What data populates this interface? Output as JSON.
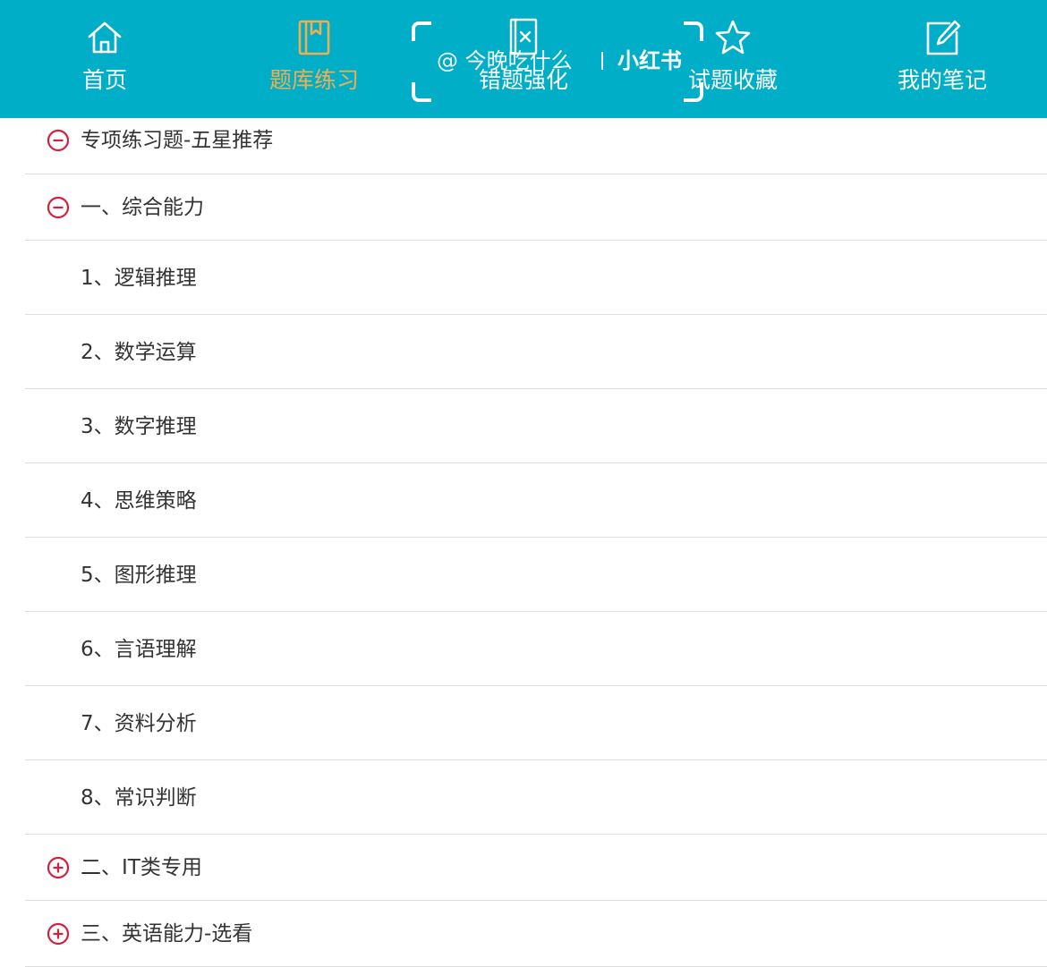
{
  "colors": {
    "accent": "#00aec8",
    "active": "#f1ad4f",
    "toggle": "#d5203d"
  },
  "tabs": [
    {
      "label": "首页",
      "icon": "home-icon",
      "active": false
    },
    {
      "label": "题库练习",
      "icon": "book-icon",
      "active": true
    },
    {
      "label": "错题强化",
      "icon": "wrong-question-icon",
      "active": false
    },
    {
      "label": "试题收藏",
      "icon": "star-icon",
      "active": false
    },
    {
      "label": "我的笔记",
      "icon": "edit-note-icon",
      "active": false
    }
  ],
  "watermark": {
    "user": "@ 今晚吃什么",
    "brand": "小红书"
  },
  "list": {
    "sections": [
      {
        "label": "专项练习题-五星推荐",
        "state": "expanded",
        "icon": "minus-circle-icon"
      },
      {
        "label": "一、综合能力",
        "state": "expanded",
        "icon": "minus-circle-icon"
      },
      {
        "label": "二、IT类专用",
        "state": "collapsed",
        "icon": "plus-circle-icon"
      },
      {
        "label": "三、英语能力-选看",
        "state": "collapsed",
        "icon": "plus-circle-icon"
      }
    ],
    "items": [
      {
        "label": "1、逻辑推理"
      },
      {
        "label": "2、数学运算"
      },
      {
        "label": "3、数字推理"
      },
      {
        "label": "4、思维策略"
      },
      {
        "label": "5、图形推理"
      },
      {
        "label": "6、言语理解"
      },
      {
        "label": "7、资料分析"
      },
      {
        "label": "8、常识判断"
      }
    ]
  }
}
